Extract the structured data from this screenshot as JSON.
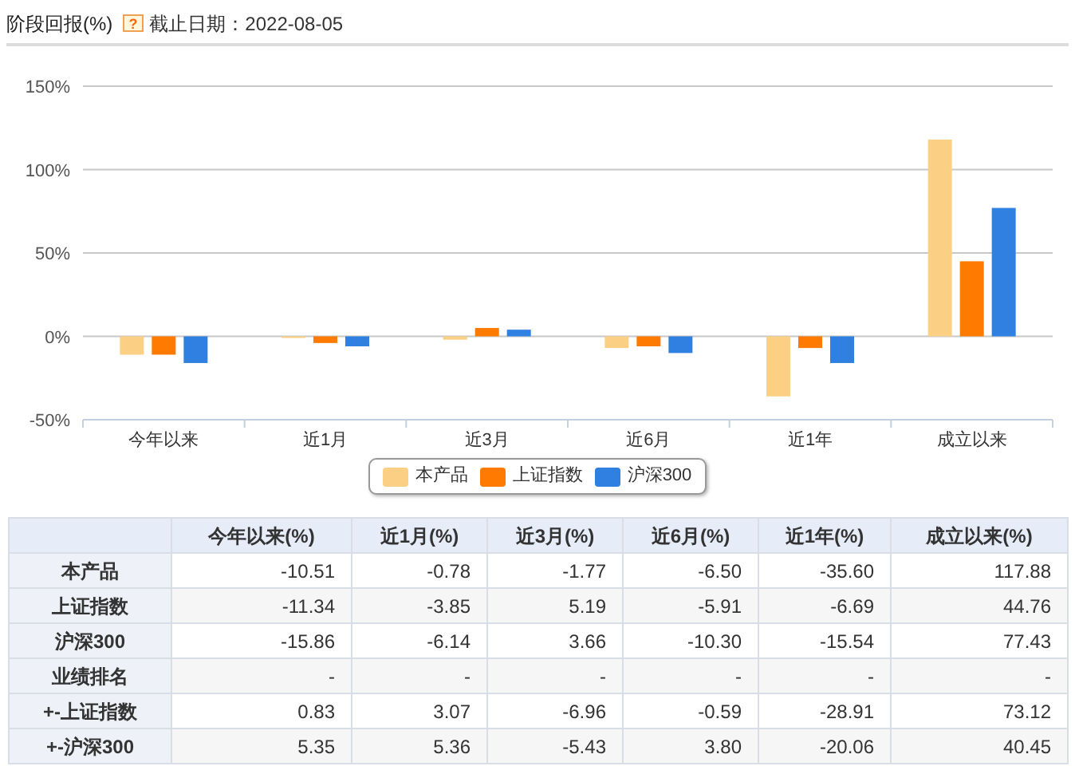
{
  "header": {
    "title": "阶段回报(%)",
    "help_icon": "?",
    "date_label": "截止日期：2022-08-05"
  },
  "chart": {
    "chart_data": {
      "type": "bar",
      "grid": true,
      "categories": [
        "今年以来",
        "近1月",
        "近3月",
        "近6月",
        "近1年",
        "成立以来"
      ],
      "series": [
        {
          "name": "本产品",
          "color": "#fbd084",
          "values": [
            -11,
            -1,
            -2,
            -7,
            -36,
            118
          ]
        },
        {
          "name": "上证指数",
          "color": "#ff7a00",
          "values": [
            -11,
            -4,
            5,
            -6,
            -7,
            45
          ]
        },
        {
          "name": "沪深300",
          "color": "#2f80e0",
          "values": [
            -16,
            -6,
            4,
            -10,
            -16,
            77
          ]
        }
      ],
      "ylim": [
        -50,
        150
      ],
      "yticks": [
        {
          "value": -50,
          "label": "-50%"
        },
        {
          "value": 0,
          "label": "0%"
        },
        {
          "value": 50,
          "label": "50%"
        },
        {
          "value": 100,
          "label": "100%"
        },
        {
          "value": 150,
          "label": "150%"
        }
      ]
    }
  },
  "table": {
    "columns": [
      "今年以来(%)",
      "近1月(%)",
      "近3月(%)",
      "近6月(%)",
      "近1年(%)",
      "成立以来(%)"
    ],
    "rows": [
      {
        "label": "本产品",
        "cells": [
          "-10.51",
          "-0.78",
          "-1.77",
          "-6.50",
          "-35.60",
          "117.88"
        ]
      },
      {
        "label": "上证指数",
        "cells": [
          "-11.34",
          "-3.85",
          "5.19",
          "-5.91",
          "-6.69",
          "44.76"
        ]
      },
      {
        "label": "沪深300",
        "cells": [
          "-15.86",
          "-6.14",
          "3.66",
          "-10.30",
          "-15.54",
          "77.43"
        ]
      },
      {
        "label": "业绩排名",
        "cells": [
          "-",
          "-",
          "-",
          "-",
          "-",
          "-"
        ]
      },
      {
        "label": "+-上证指数",
        "cells": [
          "0.83",
          "3.07",
          "-6.96",
          "-0.59",
          "-28.91",
          "73.12"
        ]
      },
      {
        "label": "+-沪深300",
        "cells": [
          "5.35",
          "5.36",
          "-5.43",
          "3.80",
          "-20.06",
          "40.45"
        ]
      }
    ]
  }
}
